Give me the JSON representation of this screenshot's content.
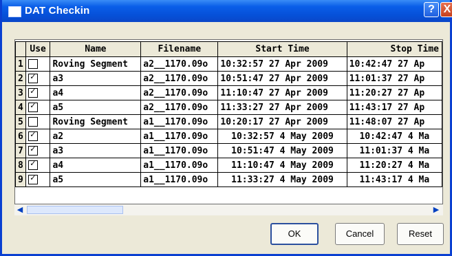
{
  "window": {
    "title": "DAT Checkin",
    "help_label": "?",
    "close_label": "X"
  },
  "grid": {
    "columns": [
      "Use",
      "Name",
      "Filename",
      "Start Time",
      "Stop Time"
    ],
    "rows": [
      {
        "num": "1",
        "use": false,
        "name": "Roving Segment",
        "filename": "a2__1170.09o",
        "start": "10:32:57 27 Apr 2009",
        "stop": "10:42:47 27 Ap"
      },
      {
        "num": "2",
        "use": true,
        "name": "a3",
        "filename": "a2__1170.09o",
        "start": "10:51:47 27 Apr 2009",
        "stop": "11:01:37 27 Ap"
      },
      {
        "num": "3",
        "use": true,
        "name": "a4",
        "filename": "a2__1170.09o",
        "start": "11:10:47 27 Apr 2009",
        "stop": "11:20:27 27 Ap"
      },
      {
        "num": "4",
        "use": true,
        "name": "a5",
        "filename": "a2__1170.09o",
        "start": "11:33:27 27 Apr 2009",
        "stop": "11:43:17 27 Ap"
      },
      {
        "num": "5",
        "use": false,
        "name": "Roving Segment",
        "filename": "a1__1170.09o",
        "start": "10:20:17 27 Apr 2009",
        "stop": "11:48:07 27 Ap"
      },
      {
        "num": "6",
        "use": true,
        "name": "a2",
        "filename": "a1__1170.09o",
        "start": "10:32:57 4 May 2009",
        "stop": "10:42:47 4 Ma"
      },
      {
        "num": "7",
        "use": true,
        "name": "a3",
        "filename": "a1__1170.09o",
        "start": "10:51:47 4 May 2009",
        "stop": "11:01:37 4 Ma"
      },
      {
        "num": "8",
        "use": true,
        "name": "a4",
        "filename": "a1__1170.09o",
        "start": "11:10:47 4 May 2009",
        "stop": "11:20:27 4 Ma"
      },
      {
        "num": "9",
        "use": true,
        "name": "a5",
        "filename": "a1__1170.09o",
        "start": "11:33:27 4 May 2009",
        "stop": "11:43:17 4 Ma"
      }
    ]
  },
  "buttons": {
    "ok": "OK",
    "cancel": "Cancel",
    "reset": "Reset"
  },
  "icons": {
    "window": "window-icon",
    "scroll_up": "chevron-up-icon",
    "scroll_down": "chevron-down-icon",
    "scroll_left": "chevron-left-icon",
    "scroll_right": "chevron-right-icon",
    "checkbox_mark": "checkmark-icon"
  },
  "colors": {
    "titlebar": "#0a5ee8",
    "dialog_bg": "#ece9d8",
    "close": "#c5401e"
  }
}
